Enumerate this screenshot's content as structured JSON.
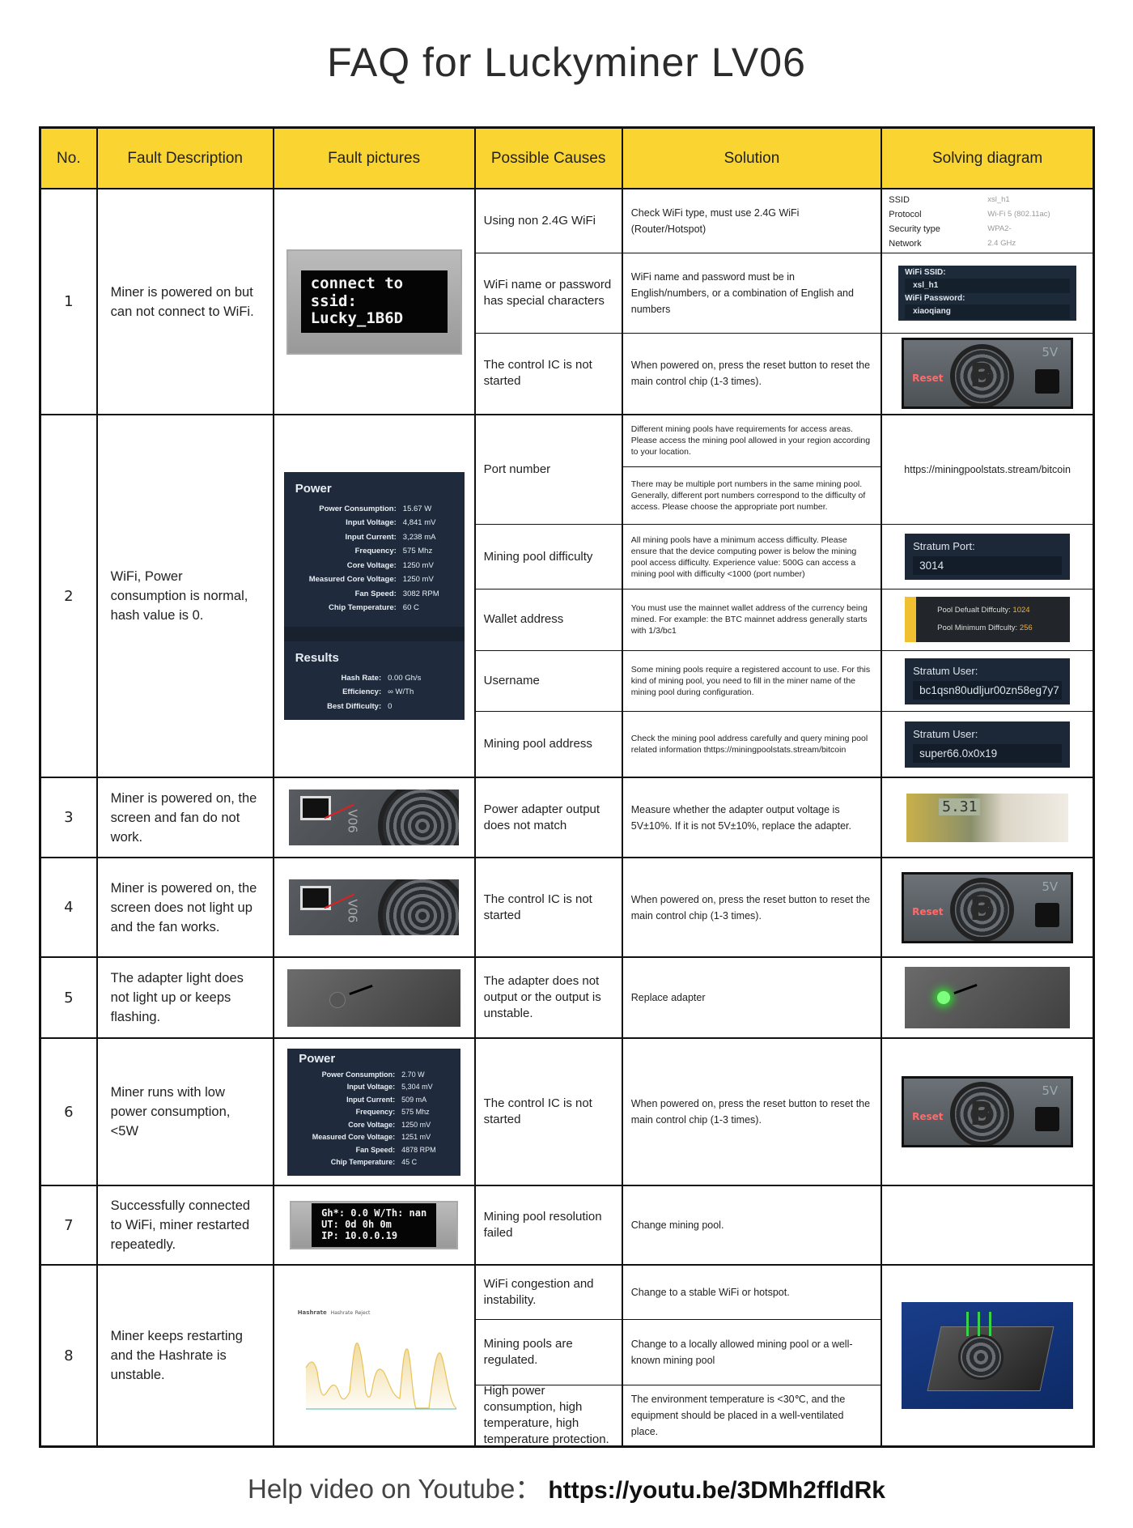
{
  "title": "FAQ for Luckyminer LV06",
  "headers": [
    "No.",
    "Fault Description",
    "Fault pictures",
    "Possible Causes",
    "Solution",
    "Solving diagram"
  ],
  "rows": [
    {
      "no": "1",
      "description": "Miner is powered on but can not connect to WiFi.",
      "picture": {
        "type": "oled",
        "lines": [
          "connect to ssid:",
          "Lucky_1B6D"
        ]
      },
      "causes": [
        {
          "cause": "Using non 2.4G WiFi",
          "solutions": [
            "Check WiFi type, must use 2.4G WiFi (Router/Hotspot)"
          ],
          "diagram": {
            "type": "wifi-props",
            "items": [
              [
                "SSID",
                "xsl_h1"
              ],
              [
                "Protocol",
                "Wi-Fi 5 (802.11ac)"
              ],
              [
                "Security type",
                "WPA2-"
              ],
              [
                "Network",
                "2.4 GHz"
              ]
            ]
          }
        },
        {
          "cause": "WiFi name or password has special characters",
          "solutions": [
            "WiFi name and password must be in English/numbers, or a combination of English and numbers"
          ],
          "diagram": {
            "type": "wifi-form",
            "ssid_label": "WiFi SSID:",
            "ssid": "xsl_h1",
            "pass_label": "WiFi Password:",
            "pass": "xiaoqiang"
          }
        },
        {
          "cause": "The control IC is not started",
          "solutions": [
            "When powered on, press the reset button to reset the main control chip (1-3 times)."
          ],
          "diagram": {
            "type": "reset-board",
            "reset_label": "Reset",
            "voltage_label": "5V",
            "logo": "B"
          }
        }
      ]
    },
    {
      "no": "2",
      "description": "WiFi, Power consumption is normal, hash value is 0.",
      "picture": {
        "type": "power-results",
        "power_title": "Power",
        "power": [
          [
            "Power Consumption:",
            "15.67 W"
          ],
          [
            "Input Voltage:",
            "4,841 mV"
          ],
          [
            "Input Current:",
            "3,238 mA"
          ],
          [
            "Frequency:",
            "575 Mhz"
          ],
          [
            "Core Voltage:",
            "1250 mV"
          ],
          [
            "Measured Core Voltage:",
            "1250 mV"
          ],
          [
            "Fan Speed:",
            "3082 RPM"
          ],
          [
            "Chip Temperature:",
            "60 C"
          ]
        ],
        "results_title": "Results",
        "results": [
          [
            "Hash Rate:",
            "0.00 Gh/s"
          ],
          [
            "Efficiency:",
            "∞ W/Th"
          ],
          [
            "Best Difficulty:",
            "0"
          ]
        ]
      },
      "causes": [
        {
          "cause": "Port number",
          "solutions": [
            "Different mining pools have requirements for access areas. Please access the mining pool allowed in your region according to your location.",
            "There may be multiple port numbers in the same mining pool. Generally, different port numbers correspond to the difficulty of access. Please choose the appropriate port number."
          ],
          "diagram": {
            "type": "url",
            "text": "https://miningpoolstats.stream/bitcoin"
          }
        },
        {
          "cause": "Mining pool difficulty",
          "solutions": [
            "All mining pools have a minimum access difficulty. Please ensure that the device computing power is below the mining pool access difficulty. Experience value: 500G can access a mining pool with difficulty <1000 (port number)"
          ],
          "diagram": {
            "type": "stratum-field",
            "label": "Stratum Port:",
            "value": "3014"
          }
        },
        {
          "cause": "Wallet address",
          "solutions": [
            "You must use the mainnet wallet address of the currency being mined. For example: the BTC mainnet address generally starts with 1/3/bc1"
          ],
          "diagram": {
            "type": "pool-difficulty",
            "default_label": "Pool Defualt Diffculty:",
            "default_value": "1024",
            "min_label": "Pool Minimum Diffculty:",
            "min_value": "256"
          }
        },
        {
          "cause": "Username",
          "solutions": [
            "Some mining pools require a registered account to use. For this kind of mining pool, you need to fill in the miner name of the mining pool during configuration."
          ],
          "diagram": {
            "type": "stratum-field",
            "label": "Stratum User:",
            "value": "bc1qsn80udljur00zn58eg7y7"
          }
        },
        {
          "cause": "Mining pool address",
          "solutions": [
            "Check the mining pool address carefully and query mining pool related information thttps://miningpoolstats.stream/bitcoin"
          ],
          "diagram": {
            "type": "stratum-field",
            "label": "Stratum User:",
            "value": "super66.0x0x19"
          }
        }
      ]
    },
    {
      "no": "3",
      "description": "Miner is powered on, the screen and fan do not work.",
      "picture": {
        "type": "device-screen",
        "model_text": "V06"
      },
      "causes": [
        {
          "cause": "Power adapter output does not match",
          "solutions": [
            "Measure whether the adapter output voltage is 5V±10%. If it is not 5V±10%, replace the adapter."
          ],
          "diagram": {
            "type": "multimeter",
            "reading": "5.31"
          }
        }
      ]
    },
    {
      "no": "4",
      "description": "Miner is powered on, the screen does not light up and the fan works.",
      "picture": {
        "type": "device-screen",
        "model_text": "V06"
      },
      "causes": [
        {
          "cause": "The control IC is not started",
          "solutions": [
            "When powered on, press the reset button to reset the main control chip (1-3 times)."
          ],
          "diagram": {
            "type": "reset-board",
            "reset_label": "Reset",
            "voltage_label": "5V",
            "logo": "B"
          }
        }
      ]
    },
    {
      "no": "5",
      "description": "The adapter light does not light up or keeps flashing.",
      "picture": {
        "type": "adapter-light",
        "lit": false
      },
      "causes": [
        {
          "cause": "The adapter does not output or the output is unstable.",
          "solutions": [
            "Replace adapter"
          ],
          "diagram": {
            "type": "green-light",
            "lit": true
          }
        }
      ]
    },
    {
      "no": "6",
      "description": "Miner runs with low power consumption, <5W",
      "picture": {
        "type": "power-panel",
        "power_title": "Power",
        "power": [
          [
            "Power Consumption:",
            "2.70 W"
          ],
          [
            "Input Voltage:",
            "5,304 mV"
          ],
          [
            "Input Current:",
            "509 mA"
          ],
          [
            "Frequency:",
            "575 Mhz"
          ],
          [
            "Core Voltage:",
            "1250 mV"
          ],
          [
            "Measured Core Voltage:",
            "1251 mV"
          ],
          [
            "Fan Speed:",
            "4878 RPM"
          ],
          [
            "Chip Temperature:",
            "45 C"
          ]
        ]
      },
      "causes": [
        {
          "cause": "The control IC is not started",
          "solutions": [
            "When powered on, press the reset button to reset the main control chip (1-3 times)."
          ],
          "diagram": {
            "type": "reset-board",
            "reset_label": "Reset",
            "voltage_label": "5V",
            "logo": "B"
          }
        }
      ]
    },
    {
      "no": "7",
      "description": "Successfully connected to WiFi, miner restarted repeatedly.",
      "picture": {
        "type": "oled",
        "lines": [
          "Gh*: 0.0 W/Th: nan",
          "UT: 0d 0h 0m",
          "IP: 10.0.0.19"
        ]
      },
      "causes": [
        {
          "cause": "Mining pool resolution failed",
          "solutions": [
            "Change mining pool."
          ],
          "diagram": {
            "type": "none"
          }
        }
      ]
    },
    {
      "no": "8",
      "description": "Miner keeps restarting and the Hashrate is unstable.",
      "picture": {
        "type": "hashrate-chart",
        "chart_title": "Hashrate",
        "legend": [
          "Hashrate",
          "Reject"
        ],
        "line_color": "#e8c25a",
        "reject_color": "#4fb8a8"
      },
      "causes": [
        {
          "cause": "WiFi congestion and instability.",
          "solutions": [
            "Change to a stable WiFi or hotspot."
          ],
          "diagram": {
            "type": "device-3d",
            "rowspan": true
          }
        },
        {
          "cause": "Mining pools are regulated.",
          "solutions": [
            "Change to a locally allowed mining pool or a well-known mining pool"
          ]
        },
        {
          "cause": "High power consumption, high temperature, high temperature protection.",
          "solutions": [
            "The environment temperature is <30℃, and the equipment should be placed in a well-ventilated place."
          ]
        }
      ]
    }
  ],
  "footer": {
    "label": "Help video on Youtube：",
    "url": "https://youtu.be/3DMh2ffIdRk"
  },
  "colors": {
    "header_bg": "#fad532",
    "panel_bg": "#1f2b3d",
    "border": "#111111"
  }
}
